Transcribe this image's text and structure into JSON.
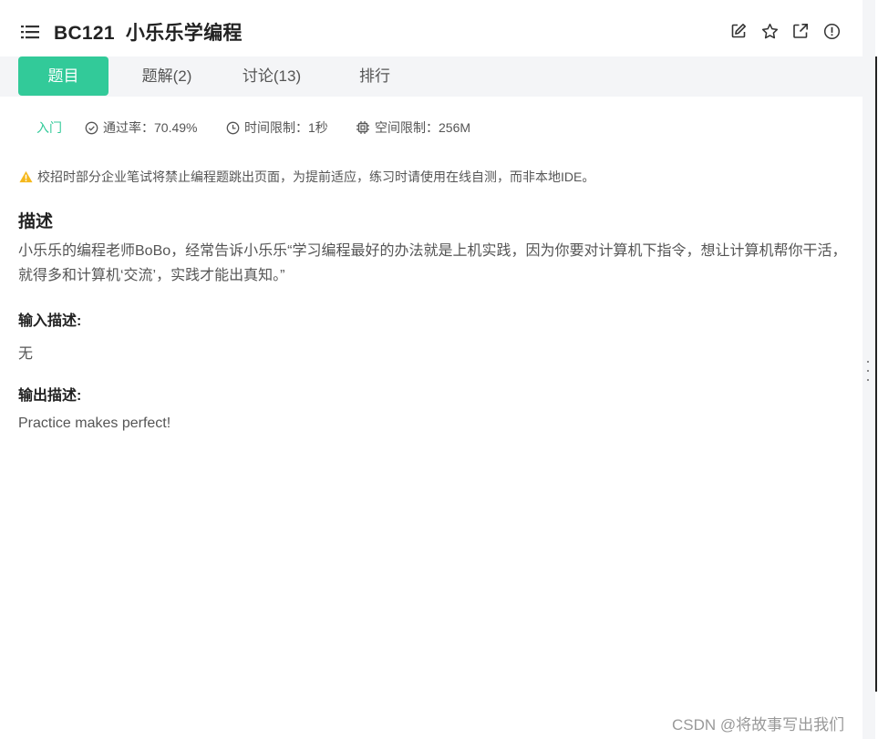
{
  "header": {
    "id": "BC121",
    "name": "小乐乐学编程",
    "actions": [
      {
        "icon": "edit-icon"
      },
      {
        "icon": "star-icon"
      },
      {
        "icon": "external-link-icon"
      },
      {
        "icon": "alert-icon"
      }
    ]
  },
  "tabs": [
    {
      "label": "题目",
      "active": true
    },
    {
      "label": "题解(2)",
      "active": false
    },
    {
      "label": "讨论(13)",
      "active": false
    },
    {
      "label": "排行",
      "active": false
    }
  ],
  "meta": {
    "level": "入门",
    "pass_rate": "通过率：70.49%",
    "time_limit": "时间限制：1秒",
    "space_limit": "空间限制：256M"
  },
  "notice": "校招时部分企业笔试将禁止编程题跳出页面，为提前适应，练习时请使用在线自测，而非本地IDE。",
  "description": {
    "heading": "描述",
    "text": "小乐乐的编程老师BoBo，经常告诉小乐乐“学习编程最好的办法就是上机实践，因为你要对计算机下指令，想让计算机帮你干活，就得多和计算机‘交流’，实践才能出真知。”"
  },
  "input": {
    "heading": "输入描述:",
    "text": "无"
  },
  "output": {
    "heading": "输出描述:",
    "text": "Practice makes perfect!"
  },
  "watermark": "CSDN @将故事写出我们",
  "colors": {
    "accent": "#32ca99",
    "tab_bar_bg": "#f4f5f7",
    "warning": "#f5b81c"
  }
}
